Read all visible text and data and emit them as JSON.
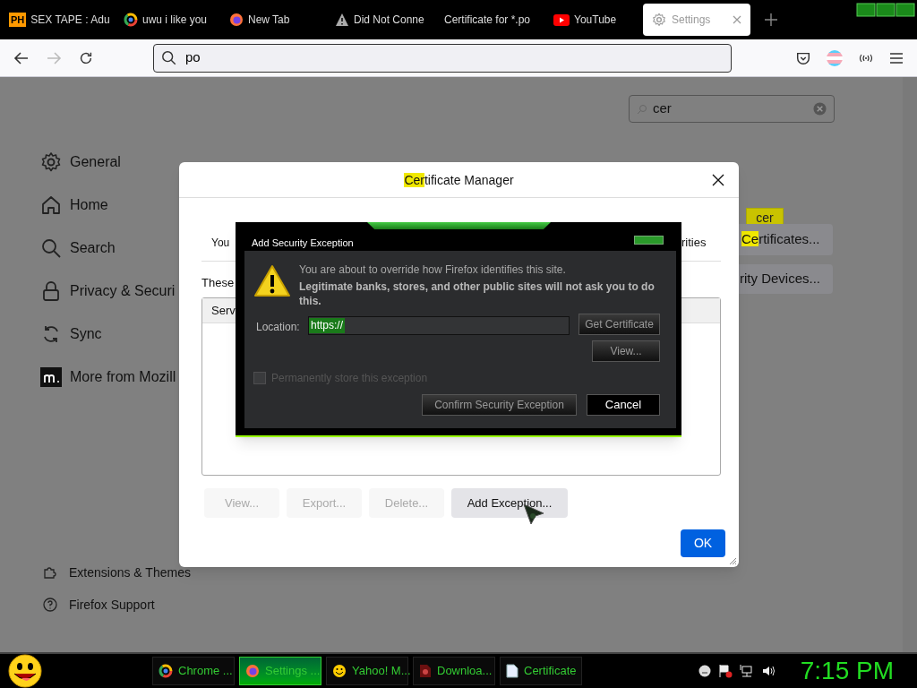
{
  "tabs": [
    {
      "label": "SEX TAPE : Adu",
      "kind": "badge",
      "badge": "PH",
      "selected": false
    },
    {
      "label": "uwu i like you",
      "kind": "ring",
      "selected": false
    },
    {
      "label": "New Tab",
      "kind": "fox",
      "selected": false
    },
    {
      "label": "Did Not Conne",
      "kind": "warning",
      "selected": false
    },
    {
      "label": "Certificate for *.po",
      "kind": "plain",
      "selected": false
    },
    {
      "label": "YouTube",
      "kind": "play",
      "selected": false
    },
    {
      "label": "Settings",
      "kind": "gear",
      "selected": true
    }
  ],
  "address_bar": {
    "value": "po"
  },
  "settings": {
    "search": {
      "value": "cer"
    },
    "nav": [
      {
        "label": "General",
        "kind": "gear"
      },
      {
        "label": "Home",
        "kind": "home"
      },
      {
        "label": "Search",
        "kind": "search"
      },
      {
        "label": "Privacy & Securi",
        "kind": "lock"
      },
      {
        "label": "Sync",
        "kind": "sync"
      },
      {
        "label": "More from Mozill",
        "kind": "m"
      }
    ],
    "footer": [
      {
        "label": "Extensions & Themes",
        "kind": "puzzle"
      },
      {
        "label": "Firefox Support",
        "kind": "help"
      }
    ],
    "tooltip": "cer",
    "buttons": [
      [
        {
          "text": "Ce",
          "highlight": true
        },
        {
          "text": "rtificates...",
          "highlight": false
        }
      ],
      [
        {
          "text": "rity Devices...",
          "highlight": false
        }
      ]
    ]
  },
  "certificate_manager": {
    "title": [
      {
        "text": "Cer",
        "highlight": true
      },
      {
        "text": "tificate Manager",
        "highlight": false
      }
    ],
    "text_left": "You",
    "text_right": "rities",
    "description": "These",
    "column": "Serv",
    "buttons": [
      {
        "label": "View...",
        "disabled": true
      },
      {
        "label": "Export...",
        "disabled": true
      },
      {
        "label": "Delete...",
        "disabled": true
      },
      {
        "label": "Add Exception...",
        "disabled": false
      }
    ],
    "ok": "OK"
  },
  "exception_dialog": {
    "title": "Add Security Exception",
    "message": "You are about to override how Firefox identifies this site.",
    "warning": "Legitimate banks, stores, and other public sites will not ask you to do this.",
    "location_label": "Location:",
    "location_value": "https://",
    "get_certificate": "Get Certificate",
    "view": "View...",
    "permanent": {
      "label": "Permanently store this exception",
      "checked": false,
      "disabled": true
    },
    "confirm": "Confirm Security Exception",
    "cancel": "Cancel"
  },
  "taskbar": {
    "items": [
      {
        "label": "Chrome ...",
        "kind": "ring",
        "selected": false
      },
      {
        "label": "Settings ...",
        "kind": "fox",
        "selected": true
      },
      {
        "label": "Yahoo! M...",
        "kind": "smiley",
        "selected": false
      },
      {
        "label": "Downloa...",
        "kind": "file",
        "selected": false
      },
      {
        "label": "Certificate",
        "kind": "doc",
        "selected": false
      }
    ],
    "clock": "7:15 PM"
  }
}
